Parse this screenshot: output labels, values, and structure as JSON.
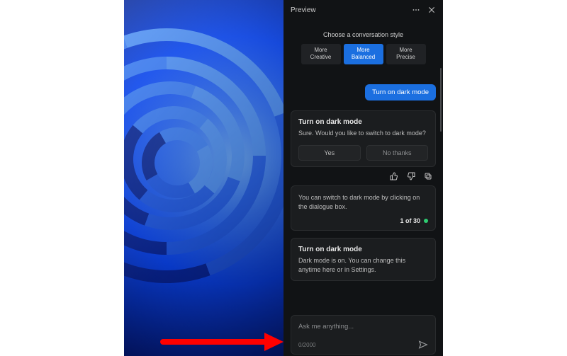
{
  "header": {
    "title": "Preview"
  },
  "style_picker": {
    "heading": "Choose a conversation style",
    "options": [
      {
        "line1": "More",
        "line2": "Creative"
      },
      {
        "line1": "More",
        "line2": "Balanced"
      },
      {
        "line1": "More",
        "line2": "Precise"
      }
    ],
    "selected_index": 1
  },
  "user_message": "Turn on dark mode",
  "response1": {
    "title": "Turn on dark mode",
    "body": "Sure. Would you like to switch to dark mode?",
    "yes_label": "Yes",
    "no_label": "No thanks"
  },
  "response2": {
    "body": "You can switch to dark mode by clicking on the dialogue box.",
    "counter": "1 of 30"
  },
  "response3": {
    "title": "Turn on dark mode",
    "body": "Dark mode is on. You can change this anytime here or in Settings."
  },
  "input": {
    "placeholder": "Ask me anything...",
    "counter": "0/2000"
  },
  "icons": {
    "more": "more-icon",
    "close": "close-icon",
    "like": "thumbs-up-icon",
    "dislike": "thumbs-down-icon",
    "copy": "copy-icon",
    "send": "send-icon"
  },
  "colors": {
    "accent": "#1b6fe0",
    "panel_bg": "#111315",
    "card_bg": "#1b1d1f",
    "success": "#2ecc71",
    "arrow": "#ff0000"
  }
}
